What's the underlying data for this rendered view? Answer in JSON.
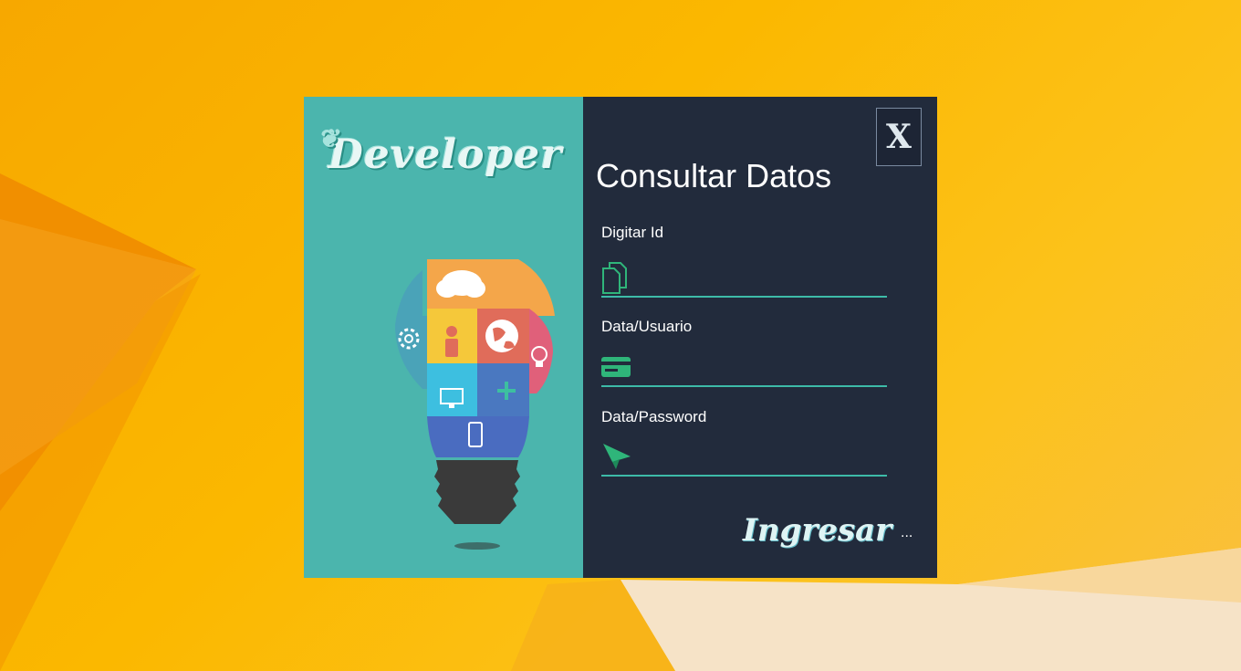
{
  "window": {
    "close_label": "X"
  },
  "brand": {
    "logo_text": "Developer"
  },
  "form": {
    "title": "Consultar Datos",
    "fields": [
      {
        "label": "Digitar Id",
        "value": "",
        "placeholder": "",
        "icon": "documents-icon"
      },
      {
        "label": "Data/Usuario",
        "value": "",
        "placeholder": "",
        "icon": "card-icon"
      },
      {
        "label": "Data/Password",
        "value": "",
        "placeholder": "",
        "icon": "paper-plane-icon"
      }
    ],
    "submit_label": "Ingresar",
    "submit_suffix": "..."
  },
  "colors": {
    "left_panel": "#4bb5ad",
    "right_panel": "#222b3c",
    "accent": "#3dbba8",
    "icon_green": "#2fb57a"
  }
}
